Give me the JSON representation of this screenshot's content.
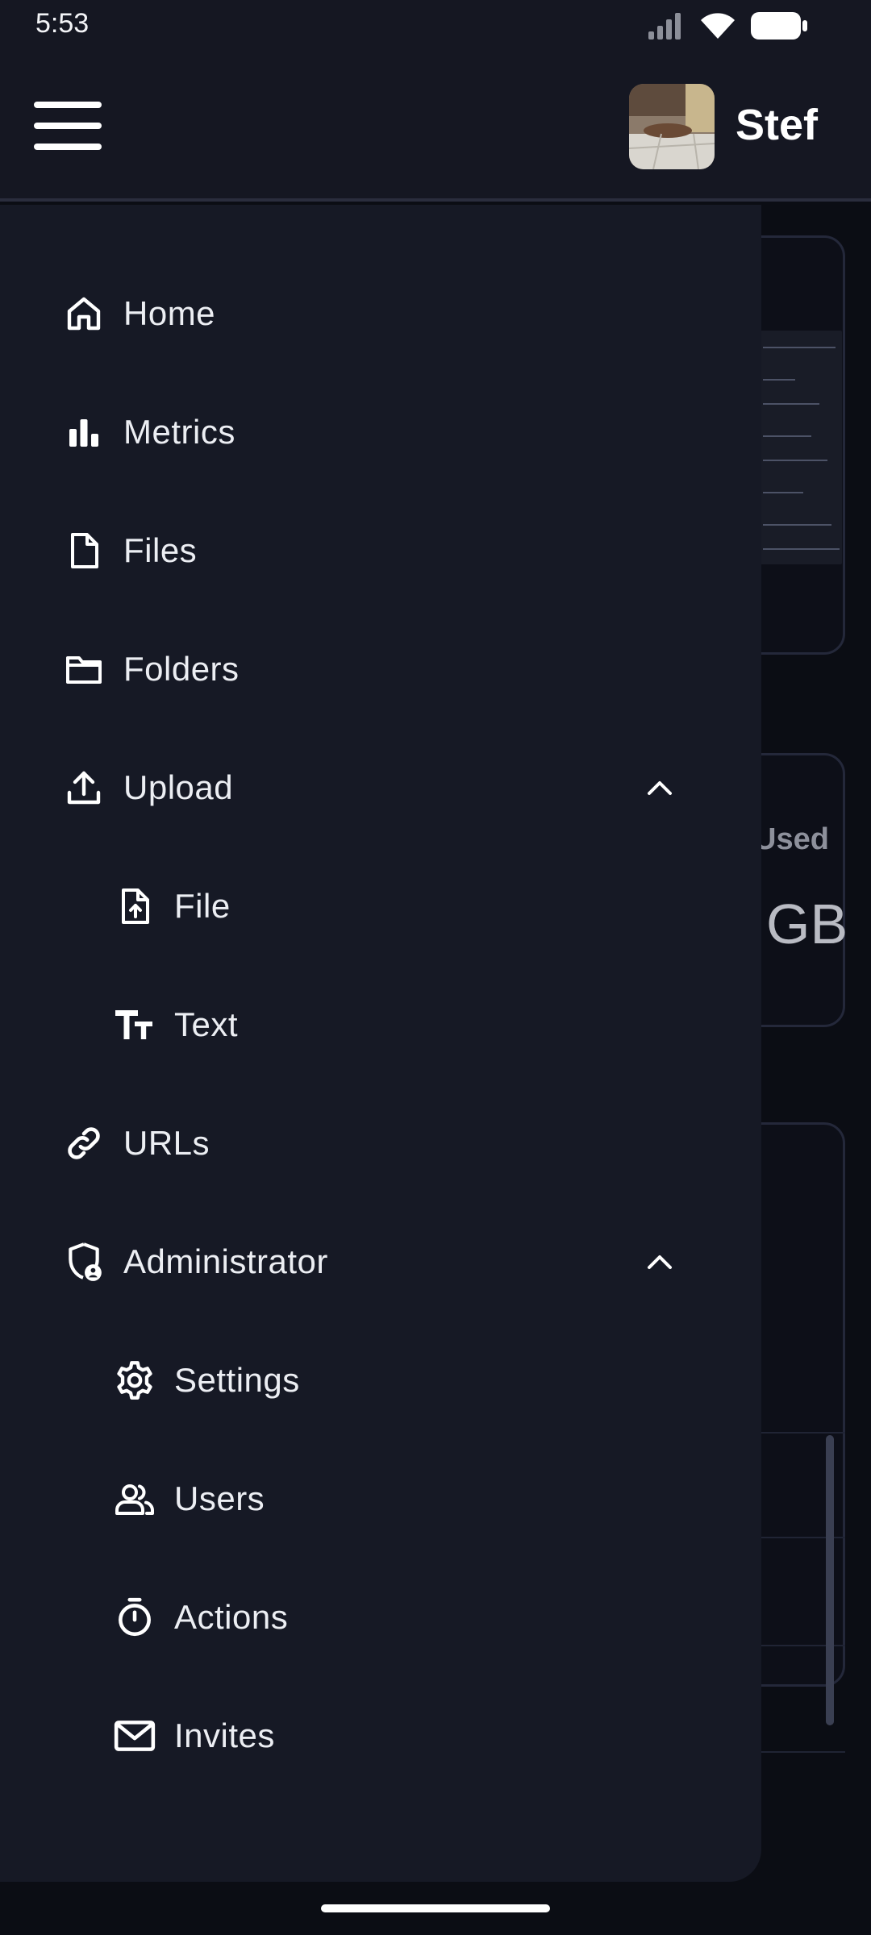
{
  "status_bar": {
    "time": "5:53",
    "icons": [
      "signal-icon",
      "wifi-icon",
      "battery-icon"
    ]
  },
  "app_bar": {
    "username": "Stef",
    "menu_icon": "hamburger-menu-icon"
  },
  "background": {
    "used_label": "Used",
    "used_value": "GB"
  },
  "drawer": {
    "items": [
      {
        "label": "Home",
        "icon": "home-icon"
      },
      {
        "label": "Metrics",
        "icon": "bar-chart-icon"
      },
      {
        "label": "Files",
        "icon": "file-icon"
      },
      {
        "label": "Folders",
        "icon": "folder-icon"
      },
      {
        "label": "Upload",
        "icon": "upload-icon",
        "expanded": true,
        "children": [
          {
            "label": "File",
            "icon": "file-upload-icon"
          },
          {
            "label": "Text",
            "icon": "text-size-icon"
          }
        ]
      },
      {
        "label": "URLs",
        "icon": "link-icon"
      },
      {
        "label": "Administrator",
        "icon": "shield-user-icon",
        "expanded": true,
        "children": [
          {
            "label": "Settings",
            "icon": "gear-icon"
          },
          {
            "label": "Users",
            "icon": "users-icon"
          },
          {
            "label": "Actions",
            "icon": "stopwatch-icon"
          },
          {
            "label": "Invites",
            "icon": "mail-icon"
          }
        ]
      }
    ]
  },
  "colors": {
    "background": "#0b0d14",
    "surface": "#151722",
    "drawer": "#161925",
    "text": "#eceef3"
  }
}
